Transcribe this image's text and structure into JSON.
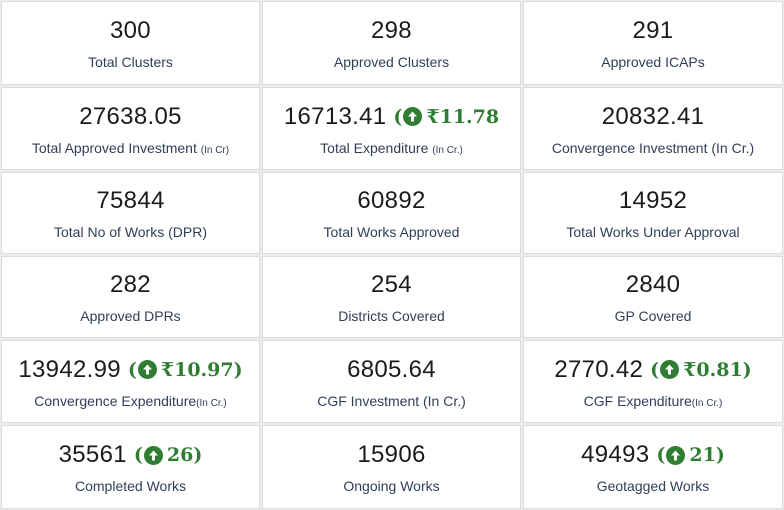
{
  "cards": [
    {
      "value": "300",
      "label": "Total Clusters",
      "suffix": ""
    },
    {
      "value": "298",
      "label": "Approved Clusters",
      "suffix": ""
    },
    {
      "value": "291",
      "label": "Approved ICAPs",
      "suffix": ""
    },
    {
      "value": "27638.05",
      "label": "Total Approved Investment",
      "suffix": "(In Cr)"
    },
    {
      "value": "16713.41",
      "label": "Total Expenditure",
      "suffix": "(In Cr.)",
      "delta": "₹11.78"
    },
    {
      "value": "20832.41",
      "label": "Convergence Investment (In Cr.)",
      "suffix": ""
    },
    {
      "value": "75844",
      "label": "Total No of Works (DPR)",
      "suffix": ""
    },
    {
      "value": "60892",
      "label": "Total Works Approved",
      "suffix": ""
    },
    {
      "value": "14952",
      "label": "Total Works Under Approval",
      "suffix": ""
    },
    {
      "value": "282",
      "label": "Approved DPRs",
      "suffix": ""
    },
    {
      "value": "254",
      "label": "Districts Covered",
      "suffix": ""
    },
    {
      "value": "2840",
      "label": "GP Covered",
      "suffix": ""
    },
    {
      "value": "13942.99",
      "label": "Convergence Expenditure",
      "suffix": "(In Cr.)",
      "delta": "₹10.97"
    },
    {
      "value": "6805.64",
      "label": "CGF Investment (In Cr.)",
      "suffix": ""
    },
    {
      "value": "2770.42",
      "label": "CGF Expenditure",
      "suffix": "(In Cr.)",
      "delta": "₹0.81"
    },
    {
      "value": "35561",
      "label": "Completed Works",
      "suffix": "",
      "delta": "26"
    },
    {
      "value": "15906",
      "label": "Ongoing Works",
      "suffix": ""
    },
    {
      "value": "49493",
      "label": "Geotagged Works",
      "suffix": "",
      "delta": "21"
    }
  ],
  "colors": {
    "delta": "#2e7d32",
    "label": "#2f3f58",
    "value": "#1b1b1b"
  },
  "icons": {
    "delta_icon": "arrow-up-circle-icon"
  }
}
